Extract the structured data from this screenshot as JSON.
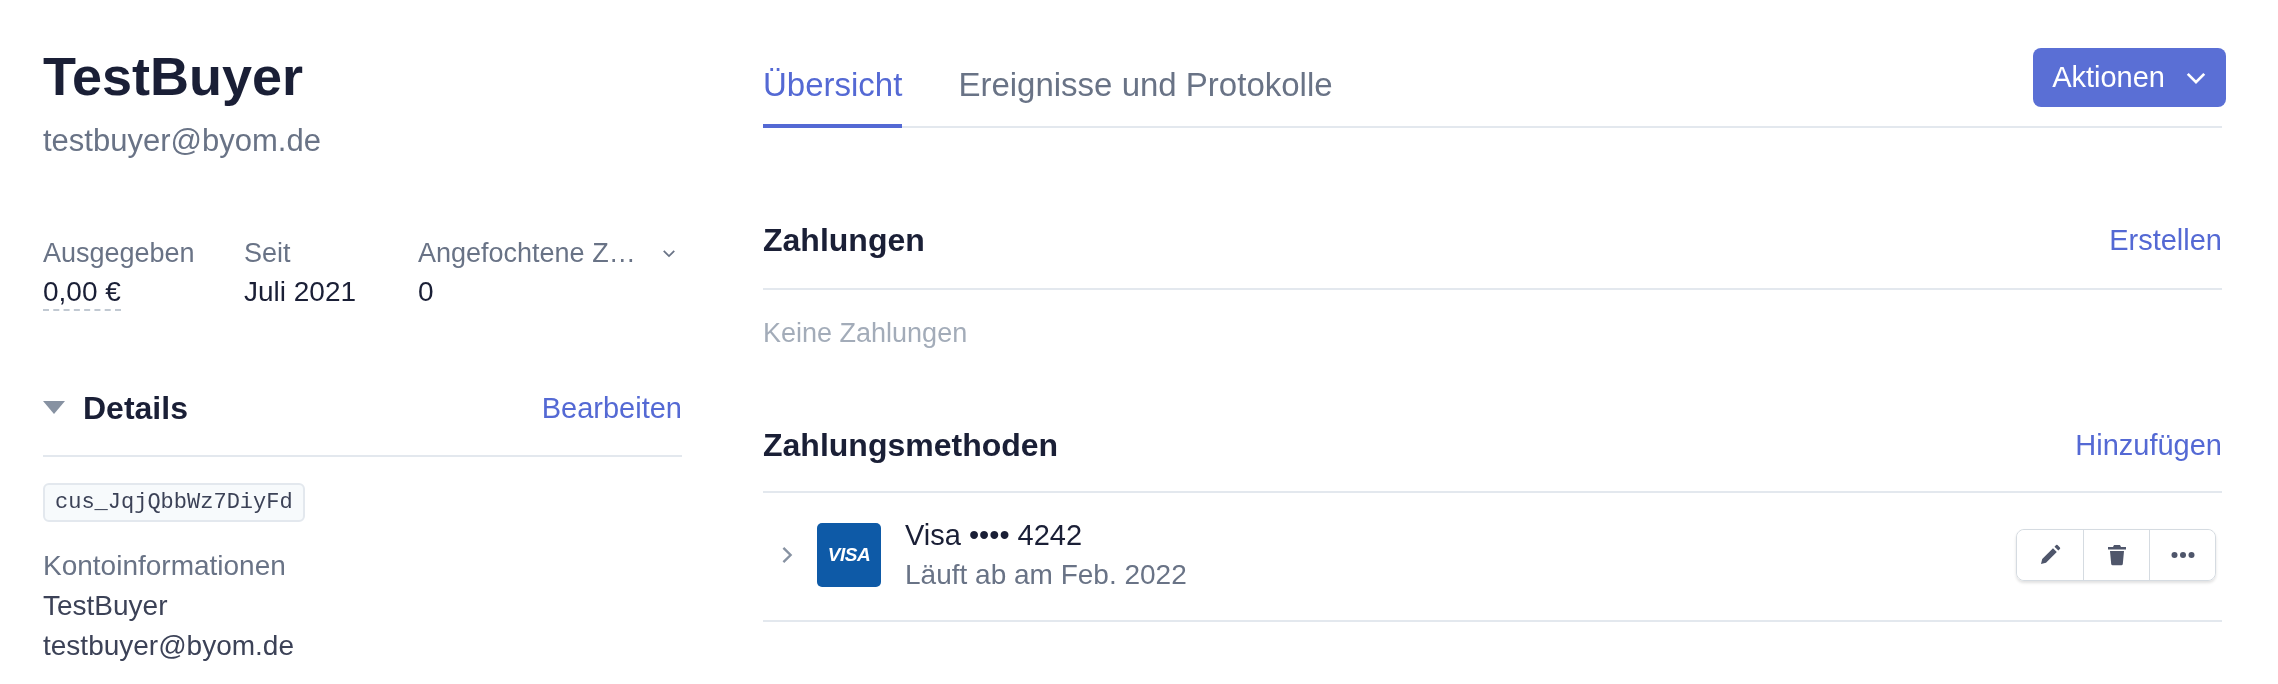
{
  "customer": {
    "name": "TestBuyer",
    "email": "testbuyer@byom.de"
  },
  "stats": [
    {
      "kind": "amount",
      "label": "Ausgegeben",
      "value": "0,00 €"
    },
    {
      "kind": "plain",
      "label": "Seit",
      "value": "Juli 2021"
    },
    {
      "kind": "dropdown",
      "label": "Angefochtene Z…",
      "value": "0"
    }
  ],
  "details": {
    "title": "Details",
    "expanded": true,
    "edit_link": "Bearbeiten",
    "customer_id": "cus_JqjQbbWz7DiyFd",
    "account_label": "Kontoinformationen",
    "account_lines": [
      "TestBuyer",
      "testbuyer@byom.de"
    ]
  },
  "tabs": [
    {
      "label": "Übersicht",
      "selected": true
    },
    {
      "label": "Ereignisse und Protokolle",
      "selected": false
    }
  ],
  "actions_button": "Aktionen",
  "payments": {
    "title": "Zahlungen",
    "action": "Erstellen",
    "empty": "Keine Zahlungen"
  },
  "payment_methods": {
    "title": "Zahlungsmethoden",
    "action": "Hinzufügen",
    "cards": [
      {
        "brand_mark": "VISA",
        "title": "Visa •••• 4242",
        "expiry": "Läuft ab am Feb. 2022",
        "expanded": false
      }
    ]
  }
}
